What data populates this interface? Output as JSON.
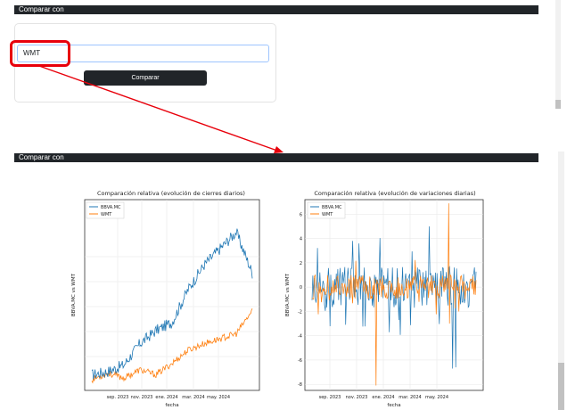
{
  "section1": {
    "header": "Comparar con"
  },
  "form": {
    "ticker_value": "WMT",
    "compare_button": "Comparar"
  },
  "section2": {
    "header": "Comparar con"
  },
  "annotation_color": "#e8000b",
  "charts": [
    {
      "title": "Comparación relativa (evolución de cierres diarios)",
      "xlabel": "fecha",
      "ylabel": "BBVA.MC vs WMT",
      "xticks": [
        "sep. 2023",
        "nov. 2023",
        "ene. 2024",
        "mar. 2024",
        "may. 2024"
      ],
      "legend": [
        "BBVA.MC",
        "WMT"
      ]
    },
    {
      "title": "Comparación relativa (evolución de variaciones diarias)",
      "xlabel": "fecha",
      "ylabel": "BBVA.MC vs WMT",
      "xticks": [
        "sep. 2023",
        "nov. 2023",
        "ene. 2024",
        "mar. 2024",
        "may. 2024"
      ],
      "yticks": [
        "6",
        "4",
        "2",
        "0",
        "-2",
        "-4",
        "-6",
        "-8"
      ],
      "legend": [
        "BBVA.MC",
        "WMT"
      ]
    }
  ],
  "chart_data": [
    {
      "type": "line",
      "title": "Comparación relativa (evolución de cierres diarios)",
      "xlabel": "fecha",
      "ylabel": "BBVA.MC vs WMT",
      "x": [
        "2023-08",
        "2023-09",
        "2023-10",
        "2023-11",
        "2023-12",
        "2024-01",
        "2024-02",
        "2024-03",
        "2024-04",
        "2024-05",
        "2024-06"
      ],
      "series": [
        {
          "name": "BBVA.MC",
          "color": "#1f77b4",
          "values": [
            0.03,
            0.05,
            0.09,
            0.22,
            0.3,
            0.35,
            0.55,
            0.7,
            0.8,
            0.9,
            0.65
          ]
        },
        {
          "name": "WMT",
          "color": "#ff7f0e",
          "values": [
            0.0,
            0.04,
            0.01,
            0.06,
            0.03,
            0.1,
            0.18,
            0.22,
            0.25,
            0.28,
            0.42
          ]
        }
      ],
      "grid": true,
      "legend_position": "top-left"
    },
    {
      "type": "line",
      "title": "Comparación relativa (evolución de variaciones diarias)",
      "xlabel": "fecha",
      "ylabel": "BBVA.MC vs WMT",
      "ylim": [
        -8.5,
        7.2
      ],
      "series": [
        {
          "name": "BBVA.MC",
          "color": "#1f77b4",
          "min": -6.7,
          "max": 5.0
        },
        {
          "name": "WMT",
          "color": "#ff7f0e",
          "min": -8.1,
          "max": 6.9
        }
      ],
      "grid": true,
      "legend_position": "top-left"
    }
  ]
}
